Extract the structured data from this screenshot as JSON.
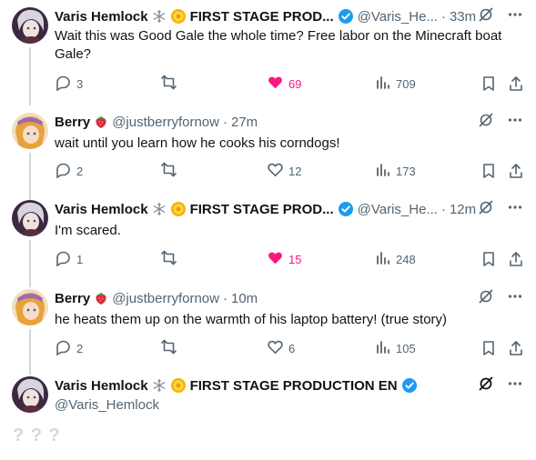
{
  "posts": [
    {
      "name": "Varis Hemlock",
      "org": "FIRST STAGE PROD...",
      "handle": "@Varis_He...",
      "time": "33m",
      "text": "Wait this was Good Gale the whole time? Free labor on the Minecraft boat Gale?",
      "replies": "3",
      "likes": "69",
      "liked": true,
      "views": "709"
    },
    {
      "name": "Berry",
      "handle": "@justberryfornow",
      "time": "27m",
      "text": "wait until you learn how he cooks his corndogs!",
      "replies": "2",
      "likes": "12",
      "liked": false,
      "views": "173"
    },
    {
      "name": "Varis Hemlock",
      "org": "FIRST STAGE PROD...",
      "handle": "@Varis_He...",
      "time": "12m",
      "text": "I'm scared.",
      "replies": "1",
      "likes": "15",
      "liked": true,
      "views": "248"
    },
    {
      "name": "Berry",
      "handle": "@justberryfornow",
      "time": "10m",
      "text": "he heats them up on the warmth of his laptop battery! (true story)",
      "replies": "2",
      "likes": "6",
      "liked": false,
      "views": "105"
    }
  ],
  "composer": {
    "name": "Varis Hemlock",
    "org": "FIRST STAGE PRODUCTION EN",
    "handle": "@Varis_Hemlock",
    "text": "? ? ?"
  },
  "separator": "·",
  "colors": {
    "like": "#f91880",
    "muted": "#536471",
    "verified": "#1d9bf0",
    "thread_line": "#cfd9de"
  },
  "icons": {
    "varis_badge": "snowflake-icon",
    "org_badge": "gold-coin-icon",
    "verified": "verified-badge-icon",
    "berry_badge": "strawberry-icon"
  }
}
